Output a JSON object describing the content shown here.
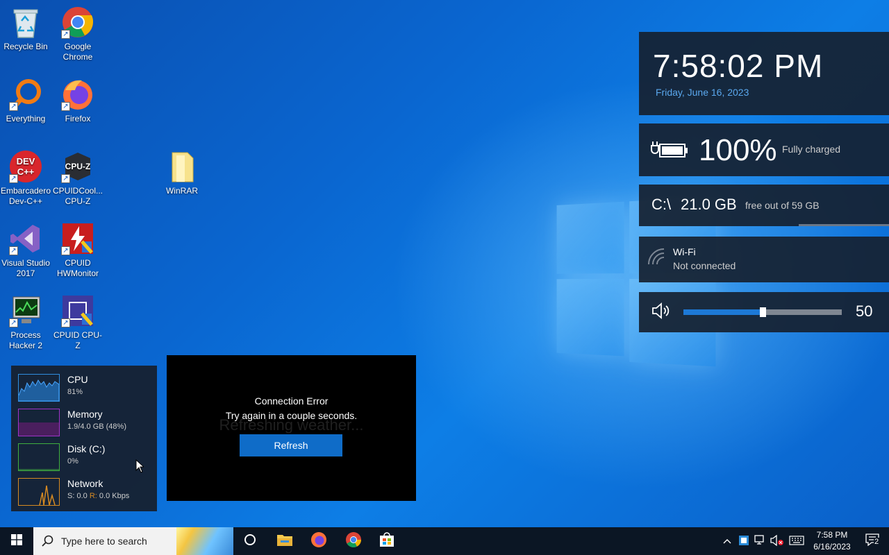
{
  "desktop": {
    "icons": [
      {
        "label": "Recycle Bin"
      },
      {
        "label": "Google Chrome"
      },
      {
        "label": "Everything"
      },
      {
        "label": "Firefox"
      },
      {
        "label": "Embarcadero Dev-C++"
      },
      {
        "label": "CPUIDCool... CPU-Z"
      },
      {
        "label": "WinRAR"
      },
      {
        "label": "Visual Studio 2017"
      },
      {
        "label": "CPUID HWMonitor"
      },
      {
        "label": "Process Hacker 2"
      },
      {
        "label": "CPUID CPU-Z"
      }
    ]
  },
  "widgets": {
    "clock": {
      "time": "7:58:02 PM",
      "date": "Friday, June 16, 2023"
    },
    "battery": {
      "percent_text": "100%",
      "status": "Fully charged",
      "level": 1.0
    },
    "disk": {
      "drive": "C:\\",
      "free": "21.0 GB",
      "detail": "free out of 59 GB"
    },
    "wifi": {
      "name": "Wi-Fi",
      "status": "Not connected"
    },
    "volume": {
      "value_text": "50",
      "level": 0.5
    }
  },
  "monitor": {
    "rows": [
      {
        "title": "CPU",
        "value": "81%",
        "color": "#2f8ee0"
      },
      {
        "title": "Memory",
        "value": "1.9/4.0 GB (48%)",
        "color": "#a033c8"
      },
      {
        "title": "Disk (C:)",
        "value": "0%",
        "color": "#3fae3f"
      },
      {
        "title": "Network",
        "value_s_label": "S:",
        "value_s": "0.0",
        "value_r_label": "R:",
        "value_r": "0.0 Kbps",
        "color": "#d68a22"
      }
    ]
  },
  "weather": {
    "ghost_text": "Refreshing weather...",
    "error_title": "Connection Error",
    "error_detail": "Try again in a couple seconds.",
    "refresh_label": "Refresh",
    "accent": "#0f6cc8"
  },
  "taskbar": {
    "search_placeholder": "Type here to search",
    "apps": [
      "cortana-icon",
      "file-explorer-icon",
      "firefox-icon",
      "chrome-icon",
      "store-icon"
    ],
    "clock_time": "7:58 PM",
    "clock_date": "6/16/2023",
    "notification_count": "2"
  }
}
